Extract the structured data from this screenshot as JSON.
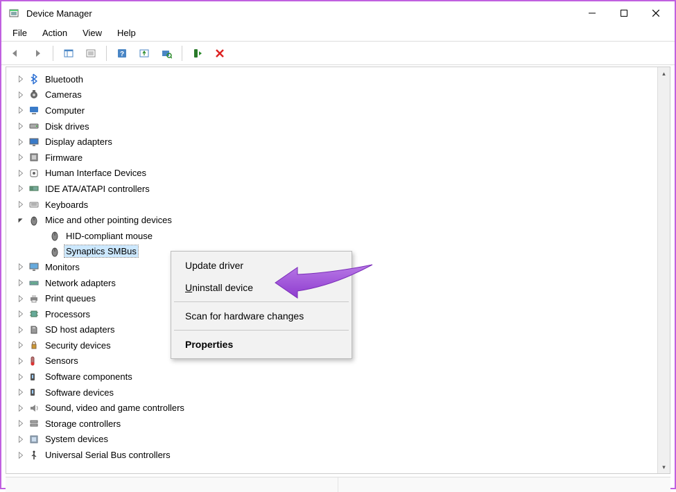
{
  "window": {
    "title": "Device Manager"
  },
  "menu": {
    "file": "File",
    "action": "Action",
    "view": "View",
    "help": "Help"
  },
  "tree": {
    "items": [
      {
        "label": "Bluetooth",
        "icon": "bluetooth"
      },
      {
        "label": "Cameras",
        "icon": "camera"
      },
      {
        "label": "Computer",
        "icon": "computer"
      },
      {
        "label": "Disk drives",
        "icon": "disk"
      },
      {
        "label": "Display adapters",
        "icon": "display"
      },
      {
        "label": "Firmware",
        "icon": "firmware"
      },
      {
        "label": "Human Interface Devices",
        "icon": "hid"
      },
      {
        "label": "IDE ATA/ATAPI controllers",
        "icon": "ide"
      },
      {
        "label": "Keyboards",
        "icon": "keyboard"
      },
      {
        "label": "Mice and other pointing devices",
        "icon": "mouse",
        "expanded": true,
        "children": [
          {
            "label": "HID-compliant mouse",
            "icon": "mouse"
          },
          {
            "label": "Synaptics SMBus ",
            "icon": "mouse",
            "selected": true,
            "truncated": true
          }
        ]
      },
      {
        "label": "Monitors",
        "icon": "monitor"
      },
      {
        "label": "Network adapters",
        "icon": "network"
      },
      {
        "label": "Print queues",
        "icon": "printer"
      },
      {
        "label": "Processors",
        "icon": "cpu"
      },
      {
        "label": "SD host adapters",
        "icon": "sd"
      },
      {
        "label": "Security devices",
        "icon": "security"
      },
      {
        "label": "Sensors",
        "icon": "sensor"
      },
      {
        "label": "Software components",
        "icon": "swcomp"
      },
      {
        "label": "Software devices",
        "icon": "swdev"
      },
      {
        "label": "Sound, video and game controllers",
        "icon": "sound"
      },
      {
        "label": "Storage controllers",
        "icon": "storage"
      },
      {
        "label": "System devices",
        "icon": "system"
      },
      {
        "label": "Universal Serial Bus controllers",
        "icon": "usb"
      }
    ]
  },
  "context_menu": {
    "update": "Update driver",
    "uninstall": "Uninstall device",
    "uninstall_prefix": "U",
    "uninstall_rest": "ninstall device",
    "scan": "Scan for hardware changes",
    "properties": "Properties"
  },
  "annotation": {
    "color": "#9b4bd6"
  }
}
